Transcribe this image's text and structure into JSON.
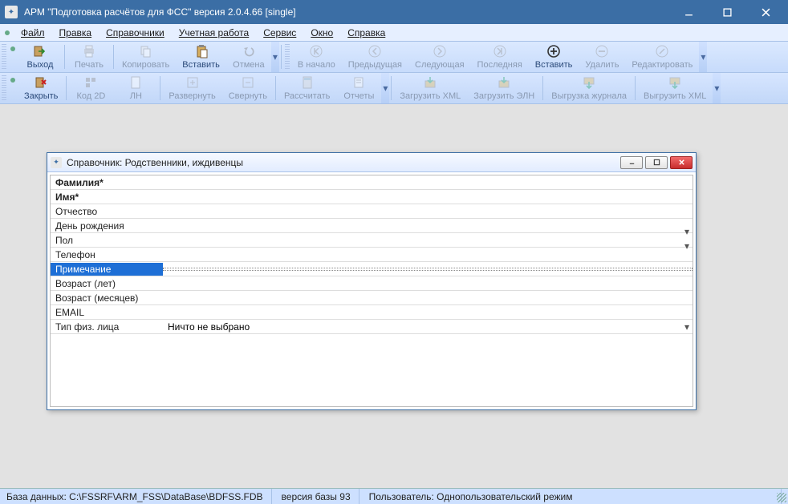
{
  "window": {
    "title": "АРМ \"Подготовка расчётов для ФСС\"   версия 2.0.4.66 [single]"
  },
  "menu": {
    "file": "Файл",
    "edit": "Правка",
    "dict": "Справочники",
    "acct": "Учетная работа",
    "service": "Сервис",
    "window": "Окно",
    "help": "Справка"
  },
  "toolbar1": {
    "exit": "Выход",
    "print": "Печать",
    "copy": "Копировать",
    "paste": "Вставить",
    "undo": "Отмена",
    "first": "В начало",
    "prev": "Предыдущая",
    "next": "Следующая",
    "last": "Последняя",
    "insert": "Вставить",
    "delete": "Удалить",
    "edit": "Редактировать"
  },
  "toolbar2": {
    "close": "Закрыть",
    "code2d": "Код 2D",
    "ln": "ЛН",
    "expand": "Развернуть",
    "collapse": "Свернуть",
    "calc": "Рассчитать",
    "reports": "Отчеты",
    "load_xml": "Загрузить XML",
    "load_eln": "Загрузить ЭЛН",
    "export_log": "Выгрузка журнала",
    "export_xml": "Выгрузить XML"
  },
  "dialog": {
    "title": "Справочник: Родственники, иждивенцы",
    "rows": [
      {
        "label": "Фамилия*",
        "bold": true,
        "value": "",
        "dropdown": false
      },
      {
        "label": "Имя*",
        "bold": true,
        "value": "",
        "dropdown": false
      },
      {
        "label": "Отчество",
        "bold": false,
        "value": "",
        "dropdown": false
      },
      {
        "label": "День рождения",
        "bold": false,
        "value": "",
        "dropdown": true
      },
      {
        "label": "Пол",
        "bold": false,
        "value": "",
        "dropdown": true
      },
      {
        "label": "Телефон",
        "bold": false,
        "value": "",
        "dropdown": false
      },
      {
        "label": "Примечание",
        "bold": false,
        "value": "",
        "dropdown": false,
        "selected": true
      },
      {
        "label": "Возраст (лет)",
        "bold": false,
        "value": "",
        "dropdown": false
      },
      {
        "label": "Возраст (месяцев)",
        "bold": false,
        "value": "",
        "dropdown": false
      },
      {
        "label": "EMAIL",
        "bold": false,
        "value": "",
        "dropdown": false
      },
      {
        "label": "Тип физ. лица",
        "bold": false,
        "value": "Ничто не выбрано",
        "dropdown": true
      }
    ]
  },
  "status": {
    "db": "База данных: C:\\FSSRF\\ARM_FSS\\DataBase\\BDFSS.FDB",
    "dbver": "версия базы 93",
    "user": "Пользователь: Однопользовательский режим"
  }
}
